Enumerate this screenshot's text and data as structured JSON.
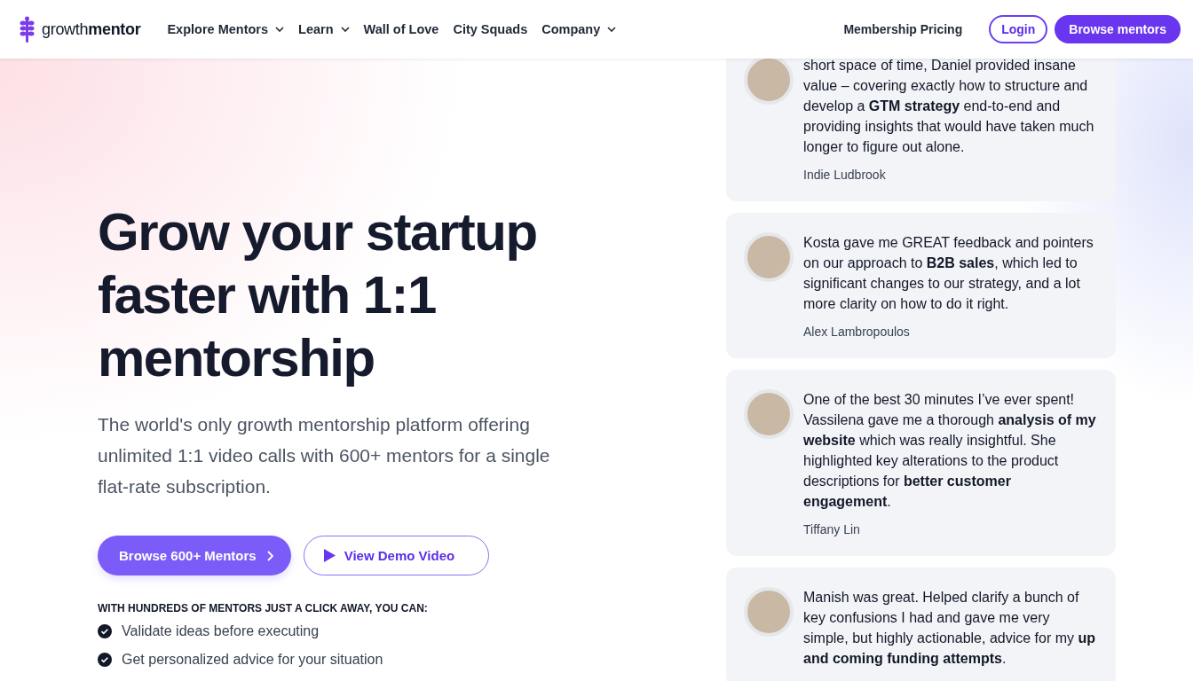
{
  "header": {
    "logo": {
      "light": "growth",
      "bold": "mentor"
    },
    "nav": [
      {
        "label": "Explore Mentors",
        "dropdown": true
      },
      {
        "label": "Learn",
        "dropdown": true
      },
      {
        "label": "Wall of Love",
        "dropdown": false
      },
      {
        "label": "City Squads",
        "dropdown": false
      },
      {
        "label": "Company",
        "dropdown": true
      }
    ],
    "pricing_link": "Membership Pricing",
    "login": "Login",
    "browse": "Browse mentors"
  },
  "hero": {
    "title": "Grow your startup faster with 1:1 mentorship",
    "subtitle": "The world's only growth mentorship platform offering unlimited 1:1 video calls with 600+ mentors for a single flat-rate subscription.",
    "primary_button": "Browse 600+ Mentors",
    "secondary_button": "View Demo Video",
    "benefits_heading": "WITH HUNDREDS OF MENTORS JUST A CLICK AWAY, YOU CAN:",
    "benefits": [
      "Validate ideas before executing",
      "Get personalized advice for your situation"
    ]
  },
  "testimonials": [
    {
      "quote": "short space of time, Daniel provided insane value – covering exactly how to structure and develop a **GTM strategy** end-to-end and providing insights that would have taken much longer to figure out alone.",
      "author": "Indie Ludbrook"
    },
    {
      "quote": "Kosta gave me GREAT feedback and pointers on our approach to **B2B sales**, which led to significant changes to our strategy, and a lot more clarity on how to do it right.",
      "author": "Alex Lambropoulos"
    },
    {
      "quote": "One of the best 30 minutes I’ve ever spent! Vassilena gave me a thorough **analysis of my website** which was really insightful. She highlighted key alterations to the product descriptions for **better customer engagement**.",
      "author": "Tiffany Lin"
    },
    {
      "quote": "Manish was great. Helped clarify a bunch of key confusions I had and gave me very simple, but highly actionable, advice for my **up and coming funding attempts**."
    }
  ]
}
